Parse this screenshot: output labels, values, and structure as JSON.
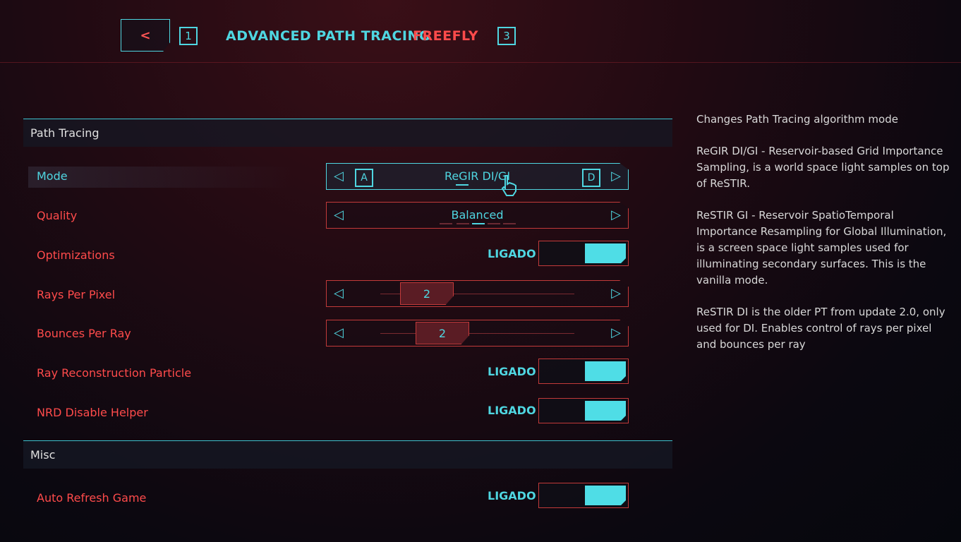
{
  "header": {
    "back_label": "<",
    "key_prev": "1",
    "active_tab": "ADVANCED PATH TRACING",
    "inactive_tab": "FREEFLY",
    "key_next": "3"
  },
  "sections": {
    "path_tracing": "Path Tracing",
    "misc": "Misc"
  },
  "settings": {
    "mode": {
      "label": "Mode",
      "value": "ReGIR DI/GI",
      "key_left": "A",
      "key_right": "D"
    },
    "quality": {
      "label": "Quality",
      "value": "Balanced"
    },
    "optimizations": {
      "label": "Optimizations",
      "state": "LIGADO"
    },
    "rays_per_pixel": {
      "label": "Rays Per Pixel",
      "value": "2"
    },
    "bounces_per_ray": {
      "label": "Bounces Per Ray",
      "value": "2"
    },
    "ray_reconstruction_particle": {
      "label": "Ray Reconstruction Particle",
      "state": "LIGADO"
    },
    "nrd_disable_helper": {
      "label": "NRD Disable Helper",
      "state": "LIGADO"
    },
    "auto_refresh_game": {
      "label": "Auto Refresh Game",
      "state": "LIGADO"
    }
  },
  "description": {
    "p1": "Changes Path Tracing algorithm mode",
    "p2": "ReGIR DI/GI - Reservoir-based Grid Importance Sampling, is a world space light samples on top of ReSTIR.",
    "p3": "ReSTIR GI - Reservoir SpatioTemporal Importance Resampling for Global Illumination, is a screen space light samples used for illuminating secondary surfaces. This is the vanilla mode.",
    "p4": "ReSTIR DI is the older PT from update 2.0, only used for DI. Enables control of rays per pixel and bounces per ray"
  },
  "icons": {
    "arrow_left": "◁",
    "arrow_right": "▷",
    "cursor": "hand-pointer-icon"
  },
  "colors": {
    "accent_cyan": "#4fd6e1",
    "accent_red": "#ff4b4b",
    "border_red": "#c23a3a"
  }
}
